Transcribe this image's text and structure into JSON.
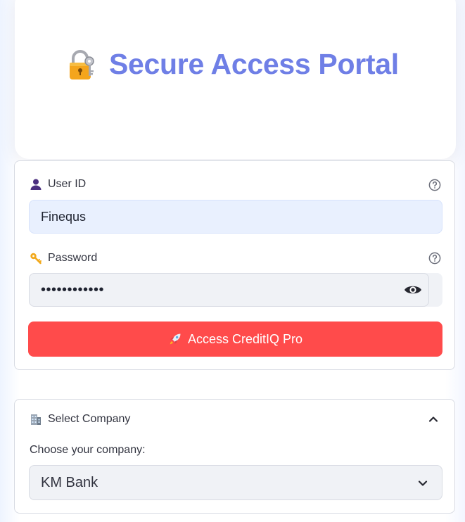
{
  "header": {
    "title": "Secure Access Portal",
    "icon": "lock-with-key-icon"
  },
  "login": {
    "user_id_label": "User ID",
    "user_id_icon": "user-silhouette-icon",
    "user_id_value": "Finequs",
    "password_label": "Password",
    "password_icon": "key-icon",
    "password_value": "••••••••••••",
    "submit_label": "Access CreditIQ Pro",
    "submit_icon": "rocket-icon"
  },
  "company": {
    "section_label": "Select Company",
    "section_icon": "office-building-icon",
    "select_caption": "Choose your company:",
    "selected_value": "KM Bank"
  },
  "colors": {
    "title": "#6f7fe6",
    "primary_button": "#ff4b4b",
    "active_input": "#e9f0fe",
    "input_background": "#f0f2f6"
  }
}
